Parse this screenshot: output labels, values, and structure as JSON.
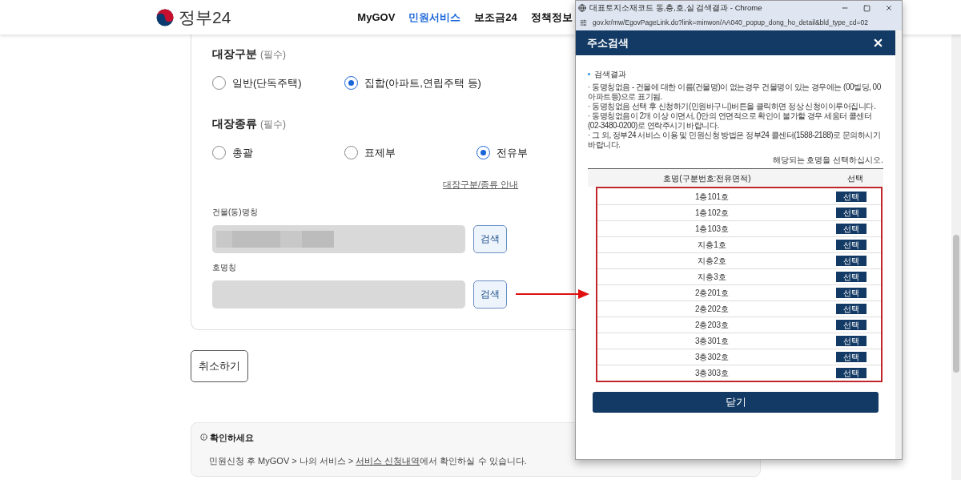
{
  "header": {
    "logo_text": "정부24",
    "nav": [
      {
        "label": "MyGOV",
        "selected": false
      },
      {
        "label": "민원서비스",
        "selected": true
      },
      {
        "label": "보조금24",
        "selected": false
      },
      {
        "label": "정책정보",
        "selected": false
      }
    ]
  },
  "form": {
    "groups": [
      {
        "label": "대장구분",
        "required": "(필수)",
        "options": [
          {
            "label": "일반(단독주택)",
            "selected": false
          },
          {
            "label": "집합(아파트,연립주택 등)",
            "selected": true
          }
        ]
      },
      {
        "label": "대장종류",
        "required": "(필수)",
        "options": [
          {
            "label": "총괄",
            "selected": false
          },
          {
            "label": "표제부",
            "selected": false
          },
          {
            "label": "전유부",
            "selected": true
          }
        ]
      }
    ],
    "guide_link": "대장구분/종류 안내",
    "fields": [
      {
        "label": "건물(동)명칭",
        "redacted": true,
        "button": "검색"
      },
      {
        "label": "호명칭",
        "redacted": false,
        "button": "검색"
      }
    ]
  },
  "cancel_button": "취소하기",
  "notice": {
    "title": "확인하세요",
    "before": "민원신청 후 MyGOV > 나의 서비스 > ",
    "link": "서비스 신청내역",
    "after": "에서 확인하실 수 있습니다."
  },
  "popup": {
    "window_title": "대표토지소재코드 동,층,호,실 검색결과 - Chrome",
    "url": "gov.kr/mw/EgovPageLink.do?link=minwon/AA040_popup_dong_ho_detail&bld_type_cd=02",
    "header_title": "주소검색",
    "section_title": "검색결과",
    "notes": [
      "· 동명칭없음 - 건물에 대한 이름(건물명)이 없는경우 건물명이 있는 경우에는 (00빌딩, 00아파트등)으로 표기됨.",
      "· 동명칭없음 선택 후 신청하기(민원바구니)버튼을 클릭하면 정상 신청이이루어집니다.",
      "· 동명칭없음이 2개 이상 이면서, ()안의 연면적으로 확인이 불가할 경우 세움터 콜센터(02-3480-0200)로 연락주시기 바랍니다.",
      "· 그 외, 정부24 서비스 이용 및 민원신청 방법은 정부24 콜센터(1588-2188)로 문의하시기 바랍니다."
    ],
    "hint": "해당되는 호명을 선택하십시오.",
    "columns": [
      "호명(구분번호:전유면적)",
      "선택"
    ],
    "rows": [
      {
        "name": "1층101호",
        "button": "선택"
      },
      {
        "name": "1층102호",
        "button": "선택"
      },
      {
        "name": "1층103호",
        "button": "선택"
      },
      {
        "name": "지층1호",
        "button": "선택"
      },
      {
        "name": "지층2호",
        "button": "선택"
      },
      {
        "name": "지층3호",
        "button": "선택"
      },
      {
        "name": "2층201호",
        "button": "선택"
      },
      {
        "name": "2층202호",
        "button": "선택"
      },
      {
        "name": "2층203호",
        "button": "선택"
      },
      {
        "name": "3층301호",
        "button": "선택"
      },
      {
        "name": "3층302호",
        "button": "선택"
      },
      {
        "name": "3층303호",
        "button": "선택"
      }
    ],
    "close_button": "닫기"
  }
}
